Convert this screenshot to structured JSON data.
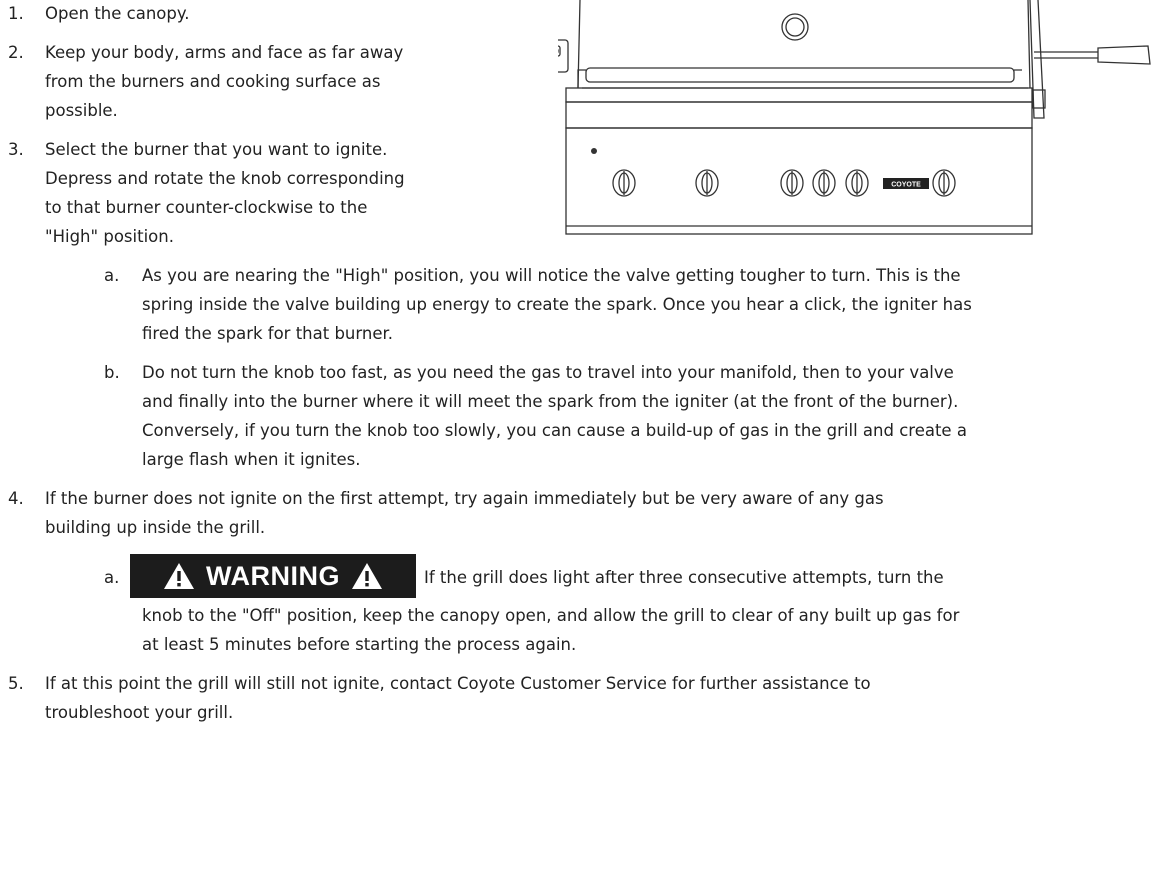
{
  "steps": [
    {
      "num": "1.",
      "lines": [
        "Open the canopy."
      ]
    },
    {
      "num": "2.",
      "lines": [
        "Keep your body, arms and face as far away",
        "from the burners and cooking surface as",
        "possible."
      ]
    },
    {
      "num": "3.",
      "lines": [
        "Select the burner that you want to ignite.",
        "Depress and rotate the knob corresponding",
        "to that burner counter-clockwise to the",
        "\"High\" position."
      ]
    },
    {
      "num": "4.",
      "lines": [
        "If the burner does not ignite on the first attempt, try again immediately but be very aware of any gas",
        "building up inside the grill."
      ]
    },
    {
      "num": "5.",
      "lines": [
        "If at this point the grill will still not ignite, contact Coyote Customer Service for further assistance to",
        "troubleshoot your grill."
      ]
    }
  ],
  "substeps_3": [
    {
      "letter": "a.",
      "lines": [
        "As you are nearing the \"High\" position, you will notice the valve getting tougher to turn. This is the",
        "spring inside the valve building up energy to create the spark. Once you hear a click, the igniter has",
        "fired the spark for that burner."
      ]
    },
    {
      "letter": "b.",
      "lines": [
        "Do not turn the knob too fast, as you need the gas to travel into your manifold, then to your valve",
        "and finally into the burner where it will meet the spark from the igniter (at the front of the burner).",
        "Conversely, if you turn the knob too slowly, you can cause a build-up of gas in the grill and create a",
        "large flash when it ignites."
      ]
    }
  ],
  "substep_4a": {
    "letter": "a.",
    "warning_label": "WARNING",
    "lines": [
      "If the grill does light after three consecutive attempts, turn the",
      "knob to the \"Off\" position, keep the canopy open, and allow the grill to clear of any built up gas for",
      "at least 5 minutes before starting the process again."
    ]
  },
  "grill": {
    "brand": "COYOTE"
  },
  "colors": {
    "text": "#222222",
    "warning_bg": "#1c1c1c",
    "warning_text": "#ffffff",
    "line_art": "#333333"
  }
}
